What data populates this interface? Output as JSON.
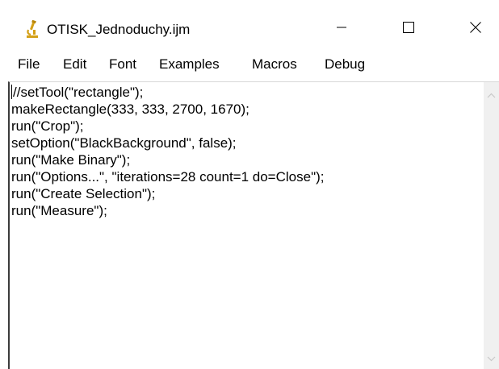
{
  "window": {
    "title": "OTISK_Jednoduchy.ijm",
    "icon": "microscope-icon",
    "controls": {
      "minimize_icon": "minimize-icon",
      "maximize_icon": "maximize-icon",
      "close_icon": "close-icon"
    }
  },
  "menubar": {
    "items": [
      "File",
      "Edit",
      "Font",
      "Examples",
      "Macros",
      "Debug"
    ]
  },
  "editor": {
    "lines": [
      "//setTool(\"rectangle\");",
      "makeRectangle(333, 333, 2700, 1670);",
      "run(\"Crop\");",
      "setOption(\"BlackBackground\", false);",
      "run(\"Make Binary\");",
      "run(\"Options...\", \"iterations=28 count=1 do=Close\");",
      "run(\"Create Selection\");",
      "run(\"Measure\");"
    ]
  },
  "colors": {
    "icon_accent": "#d4a017",
    "background": "#ffffff",
    "scrollbar": "#f0f0f0"
  }
}
